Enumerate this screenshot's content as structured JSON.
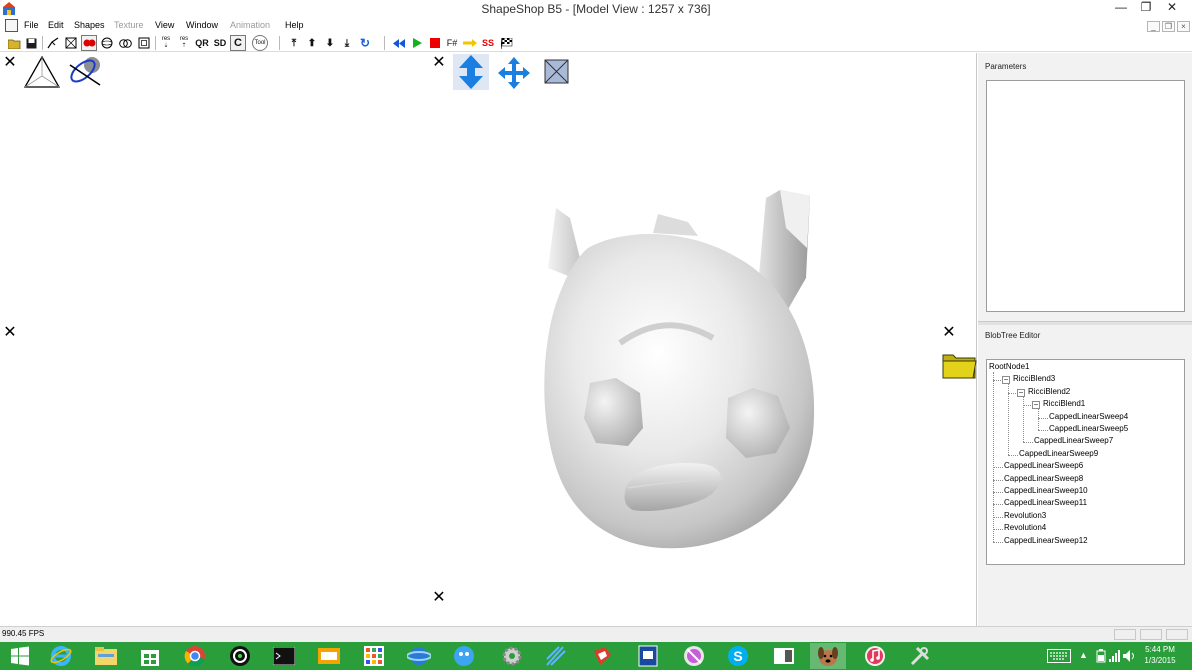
{
  "window": {
    "title": "ShapeShop B5 - [Model View : 1257 x 736]",
    "minimize_glyph": "—",
    "restore_glyph": "❐",
    "close_glyph": "✕"
  },
  "menu": {
    "items": [
      {
        "label": "File",
        "enabled": true
      },
      {
        "label": "Edit",
        "enabled": true
      },
      {
        "label": "Shapes",
        "enabled": true
      },
      {
        "label": "Texture",
        "enabled": false
      },
      {
        "label": "View",
        "enabled": true
      },
      {
        "label": "Window",
        "enabled": true
      },
      {
        "label": "Animation",
        "enabled": false
      },
      {
        "label": "Help",
        "enabled": true
      }
    ],
    "mdi_minimize_glyph": "_",
    "mdi_restore_glyph": "❐",
    "mdi_close_glyph": "×"
  },
  "toolbar": {
    "res_up_label": "res",
    "res_down_label": "res",
    "qr_label": "QR",
    "sd_label": "SD",
    "c_label": "C",
    "tool_label": "Tool",
    "f_hash_label": "F#",
    "ss_label": "SS"
  },
  "viewport": {
    "close_glyph": "✕"
  },
  "panels": {
    "parameters_title": "Parameters",
    "blobtree_title": "BlobTree Editor"
  },
  "blobtree": {
    "nodes": [
      {
        "label": "RootNode1",
        "depth": 0,
        "expander": ""
      },
      {
        "label": "RicciBlend3",
        "depth": 1,
        "expander": "−"
      },
      {
        "label": "RicciBlend2",
        "depth": 2,
        "expander": "−"
      },
      {
        "label": "RicciBlend1",
        "depth": 3,
        "expander": "−"
      },
      {
        "label": "CappedLinearSweep4",
        "depth": 4,
        "expander": ""
      },
      {
        "label": "CappedLinearSweep5",
        "depth": 4,
        "expander": ""
      },
      {
        "label": "CappedLinearSweep7",
        "depth": 3,
        "expander": ""
      },
      {
        "label": "CappedLinearSweep9",
        "depth": 2,
        "expander": ""
      },
      {
        "label": "CappedLinearSweep6",
        "depth": 1,
        "expander": ""
      },
      {
        "label": "CappedLinearSweep8",
        "depth": 1,
        "expander": ""
      },
      {
        "label": "CappedLinearSweep10",
        "depth": 1,
        "expander": ""
      },
      {
        "label": "CappedLinearSweep11",
        "depth": 1,
        "expander": ""
      },
      {
        "label": "Revolution3",
        "depth": 1,
        "expander": ""
      },
      {
        "label": "Revolution4",
        "depth": 1,
        "expander": ""
      },
      {
        "label": "CappedLinearSweep12",
        "depth": 1,
        "expander": ""
      }
    ]
  },
  "status": {
    "fps": "990.45 FPS"
  },
  "taskbar": {
    "time": "5:44 PM",
    "date": "1/3/2015"
  },
  "colors": {
    "taskbar": "#2b9e3c",
    "accent_blue": "#1a7fe0",
    "folder_yellow": "#e3d21a"
  }
}
